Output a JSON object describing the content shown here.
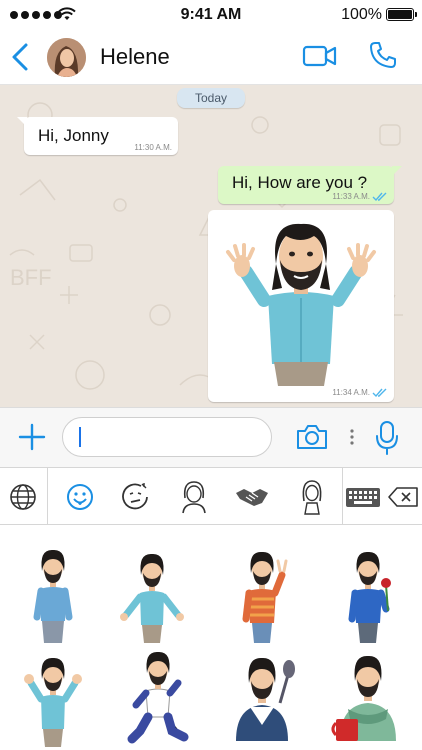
{
  "status_bar": {
    "time": "9:41 AM",
    "battery_percent": "100%"
  },
  "header": {
    "contact_name": "Helene",
    "back_icon": "chevron-left-icon",
    "video_icon": "video-camera-icon",
    "phone_icon": "phone-icon"
  },
  "chat": {
    "date_label": "Today",
    "messages": [
      {
        "direction": "incoming",
        "text": "Hi, Jonny",
        "time": "11:30 A.M."
      },
      {
        "direction": "outgoing",
        "text": "Hi, How are you ?",
        "time": "11:33 A.M.",
        "status": "read"
      },
      {
        "direction": "outgoing",
        "type": "sticker",
        "sticker": "man-waving-both-hands",
        "time": "11:34 A.M.",
        "status": "read"
      }
    ]
  },
  "input_bar": {
    "text": "",
    "icons": [
      "plus-icon",
      "camera-icon",
      "more-dots-icon",
      "microphone-icon"
    ]
  },
  "keyboard": {
    "tabs": [
      {
        "icon": "globe-icon",
        "selected": false
      },
      {
        "icon": "smiley-icon",
        "selected": true
      },
      {
        "icon": "thinking-face-icon",
        "selected": false
      },
      {
        "icon": "woman-avatar-icon",
        "selected": false
      },
      {
        "icon": "handshake-icon",
        "selected": false
      },
      {
        "icon": "girl-avatar-icon",
        "selected": false
      },
      {
        "icon": "keyboard-icon",
        "selected": false
      },
      {
        "icon": "backspace-icon",
        "selected": false
      }
    ],
    "stickers": [
      "man-standing",
      "man-shrugging",
      "man-peace-sign",
      "man-holding-rose",
      "man-waving-both-hands",
      "man-dancing",
      "man-with-spoon",
      "man-with-coffee-mug"
    ]
  },
  "colors": {
    "accent": "#1a8fe3",
    "chat_background": "#ece5dd",
    "outgoing_bubble": "#dcf8c6",
    "incoming_bubble": "#ffffff",
    "read_ticks": "#4fb6ec"
  }
}
